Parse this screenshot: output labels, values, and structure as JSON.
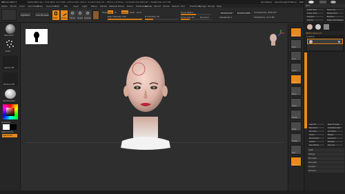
{
  "window": {
    "title": "ZBrush 2021.7",
    "doc_info": "DefaultZScript  • Free Mem 10.77GB • Active Mem 2024 • Scratch Disk 22 • ZTime 1.0 Timer • ActivePoints 458,197 • TotalPoints 12.5 Mil",
    "quicksave": "QuickSave",
    "see_through": "See-through 0",
    "menus_label": "Menus",
    "default_zscript": "DefaultZScript"
  },
  "menu_bar": [
    "Alpha",
    "Brush",
    "Color",
    "Document",
    "Draw",
    "Dynamics",
    "Edit",
    "File",
    "Layer",
    "Light",
    "Macro",
    "Marker",
    "Material",
    "Movie",
    "Picker",
    "Preferences",
    "Render",
    "Stencil",
    "Stroke",
    "Texture",
    "Tool",
    "Transform",
    "Zplugin",
    "Zscript",
    "Help"
  ],
  "toolbar": {
    "lightbox": "LightBox",
    "live_boolean": "Live Boolean",
    "edit": "Edit",
    "draw": "Draw",
    "move": "Move",
    "scale": "Scale",
    "rotate": "Rotate",
    "mrgb": "Mrgb",
    "rgb": "Rgb",
    "m": "M",
    "zadd": "Zadd",
    "zsub": "Zsub",
    "zcut": "Zcut",
    "focal_shift": "Focal Shift 0",
    "draw_size": "Draw Size 64",
    "dynamic": "Dynamic",
    "rgb_intensity": "Rgb Intensity 100",
    "z_intensity": "Z Intensity 25",
    "active_points": "ActivePoints: 458,197",
    "total_points": "TotalPoints: 12.5 Mil",
    "replay_last": "ReplayLast",
    "replay_last_rel": "ReplayLastRel",
    "adjust_last": "AdjustLast 1",
    "focal_shift_value": 0.5,
    "draw_size_value": 0.3,
    "rgb_intensity_value": 1.0,
    "z_intensity_value": 0.25
  },
  "left_shelf": {
    "standard": "Standard",
    "dots": "Dots",
    "alpha_off": "Alpha Off",
    "texture_off": "Texture Off",
    "matcap": "SkinShade4",
    "gradient": "Gradient",
    "switch_color": "SwitchColor",
    "alternate": "Alternate"
  },
  "right_shelf": [
    "Persp",
    "Floor",
    "Local",
    "LSym",
    "Frame",
    "Move",
    "Scale",
    "Rotate",
    "PolyF",
    "Transp",
    "Solo",
    "Xpose"
  ],
  "tool_panel": {
    "title": "Tool",
    "load_tool": "Load Tool",
    "save_as": "Save As",
    "copy_tool": "Copy Tool",
    "paste_tool": "Paste Tool",
    "import": "Import",
    "export": "Export",
    "clone": "Clone",
    "make_polymesh": "Make PolyMesh3D",
    "goz": "GoZ",
    "all": "All",
    "visible": "Visible",
    "r": "R",
    "current_tool": "PM3D_Head_01",
    "subtool_label": "SubTool",
    "geometry": "Geometry",
    "list_all": "List All",
    "new_folder": "New Folder",
    "rename": "Rename",
    "autoreorder": "AutoReorder",
    "all_low": "All Low",
    "all_high": "All High",
    "copy": "Copy",
    "paste": "Paste",
    "duplicate": "Duplicate",
    "append": "Append",
    "insert": "Insert",
    "delete": "Delete",
    "del_other": "Del Other",
    "del_all": "Del All",
    "split": "Split",
    "merge": "Merge",
    "boolean": "Boolean",
    "remesh": "Remesh",
    "project": "Project",
    "extract": "Extract",
    "sections": [
      "Split",
      "Merge",
      "Boolean",
      "Remesh",
      "Project",
      "Extract"
    ]
  },
  "canvas": {
    "background": "#2e2e2e",
    "accent": "#e88a1a"
  }
}
